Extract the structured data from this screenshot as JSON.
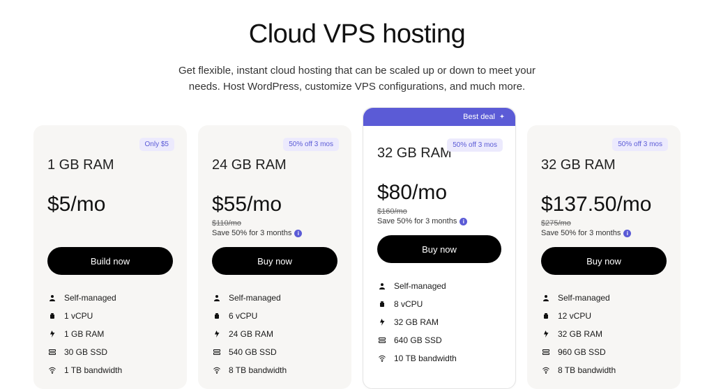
{
  "hero": {
    "title": "Cloud VPS hosting",
    "subtitle": "Get flexible, instant cloud hosting that can be scaled up or down to meet your needs. Host WordPress, customize VPS configurations, and much more."
  },
  "best_deal_label": "Best deal",
  "plans": [
    {
      "badge": "Only $5",
      "title": "1 GB RAM",
      "price": "$5",
      "per": "/mo",
      "orig": "",
      "save": "",
      "cta": "Build now",
      "features": [
        "Self-managed",
        "1 vCPU",
        "1 GB RAM",
        "30 GB SSD",
        "1 TB bandwidth"
      ]
    },
    {
      "badge": "50% off 3 mos",
      "title": "24 GB RAM",
      "price": "$55",
      "per": "/mo",
      "orig": "$110/mo",
      "save": "Save 50% for 3 months",
      "cta": "Buy now",
      "features": [
        "Self-managed",
        "6 vCPU",
        "24 GB RAM",
        "540 GB SSD",
        "8 TB bandwidth"
      ]
    },
    {
      "badge": "50% off 3 mos",
      "title": "32 GB RAM",
      "price": "$80",
      "per": "/mo",
      "orig": "$160/mo",
      "save": "Save 50% for 3 months",
      "cta": "Buy now",
      "features": [
        "Self-managed",
        "8 vCPU",
        "32 GB RAM",
        "640 GB SSD",
        "10 TB bandwidth"
      ]
    },
    {
      "badge": "50% off 3 mos",
      "title": "32 GB RAM",
      "price": "$137.50",
      "per": "/mo",
      "orig": "$275/mo",
      "save": "Save 50% for 3 months",
      "cta": "Buy now",
      "features": [
        "Self-managed",
        "12 vCPU",
        "32 GB RAM",
        "960 GB SSD",
        "8 TB bandwidth"
      ]
    }
  ]
}
